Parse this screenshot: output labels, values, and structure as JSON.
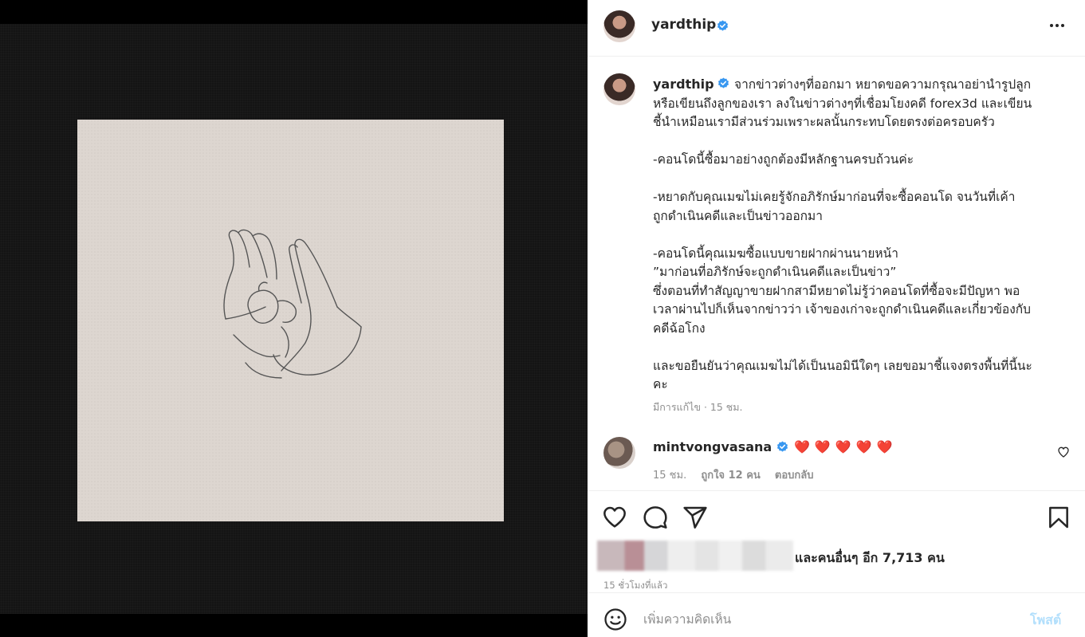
{
  "post": {
    "author": "yardthip",
    "caption": [
      "จากข่าวต่างๆที่ออกมา หยาดขอความกรุณาอย่านำรูปลูก",
      "หรือเขียนถึงลูกของเรา ลงในข่าวต่างๆที่เชื่อมโยงคดี forex3d และเขียน",
      "ชี้นำเหมือนเรามีส่วนร่วมเพราะผลนั้นกระทบโดยตรงต่อครอบครัว",
      "",
      "-คอนโดนี้ซื้อมาอย่างถูกต้องมีหลักฐานครบถ้วนค่ะ",
      "",
      "-หยาดกับคุณเมฆไม่เคยรู้จักอภิรักษ์มาก่อนที่จะซื้อคอนโด จนวันที่เค้า",
      "ถูกดำเนินคดีและเป็นข่าวออกมา",
      "",
      "-คอนโดนี้คุณเมฆซื้อแบบขายฝากผ่านนายหน้า",
      "”มาก่อนที่อภิรักษ์จะถูกดำเนินคดีและเป็นข่าว”",
      "ซึ่งตอนที่ทำสัญญาขายฝากสามีหยาดไม่รู้ว่าคอนโดที่ซื้อจะมีปัญหา พอ",
      "เวลาผ่านไปก็เห็นจากข่าวว่า เจ้าของเก่าจะถูกดำเนินคดีและเกี่ยวข้องกับ",
      "คดีฉ้อโกง",
      "",
      "และขอยืนยันว่าคุณเมฆไม่ได้เป็นนอมินีใดๆ เลยขอมาชี้แจงตรงพื้นที่นี้นะ",
      "คะ"
    ],
    "edited_meta": "มีการแก้ไข · 15 ชม.",
    "likes_text": "และคนอื่นๆ อีก 7,713 คน",
    "time_ago": "15 ชั่วโมงที่แล้ว"
  },
  "comment": {
    "username": "mintvongvasana",
    "text": "❤️❤️❤️❤️❤️",
    "time": "15 ชม.",
    "likes": "ถูกใจ 12 คน",
    "reply": "ตอบกลับ"
  },
  "comment_box": {
    "placeholder": "เพิ่มความคิดเห็น",
    "post_label": "โพสต์"
  },
  "icons": {
    "more": "more-options-icon",
    "verified": "verified-badge-icon",
    "like": "heart-icon",
    "comment": "comment-icon",
    "share": "share-icon",
    "save": "bookmark-icon",
    "emoji": "emoji-icon"
  },
  "colors": {
    "verified": "#3897f0",
    "post_button_disabled": "#b2dffc",
    "heart": "#ed1c24"
  }
}
